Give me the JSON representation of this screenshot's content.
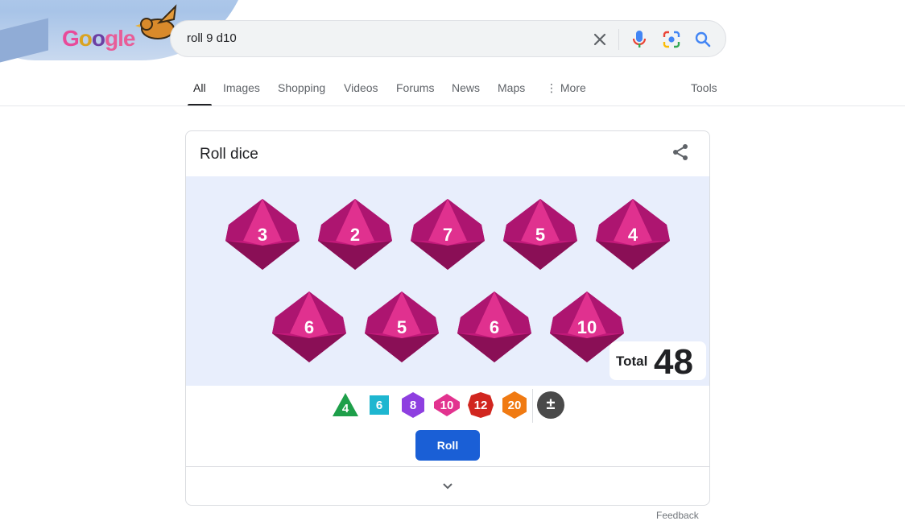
{
  "doodle": {
    "logo_letters": [
      "G",
      "o",
      "o",
      "g",
      "le"
    ]
  },
  "search": {
    "query": "roll 9 d10"
  },
  "tabs": [
    {
      "label": "All"
    },
    {
      "label": "Images"
    },
    {
      "label": "Shopping"
    },
    {
      "label": "Videos"
    },
    {
      "label": "Forums"
    },
    {
      "label": "News"
    },
    {
      "label": "Maps"
    },
    {
      "label": "⋮ More"
    }
  ],
  "tools_label": "Tools",
  "card": {
    "title": "Roll dice",
    "dice": [
      "3",
      "2",
      "7",
      "5",
      "4",
      "6",
      "5",
      "6",
      "10"
    ],
    "total_label": "Total",
    "total_value": "48",
    "selectors": [
      {
        "label": "4",
        "color": "#1e9f4a"
      },
      {
        "label": "6",
        "color": "#1eb6d0"
      },
      {
        "label": "8",
        "color": "#8e3fe0"
      },
      {
        "label": "10",
        "color": "#e2338f"
      },
      {
        "label": "12",
        "color": "#d1261f"
      },
      {
        "label": "20",
        "color": "#f07a12"
      },
      {
        "label": "±",
        "color": "#4a4a4a"
      }
    ],
    "roll_label": "Roll"
  },
  "feedback_label": "Feedback",
  "colors": {
    "die_main": "#c2197a",
    "die_light": "#e0318f",
    "die_dark": "#8a0f56",
    "accent": "#1a5fd6"
  }
}
